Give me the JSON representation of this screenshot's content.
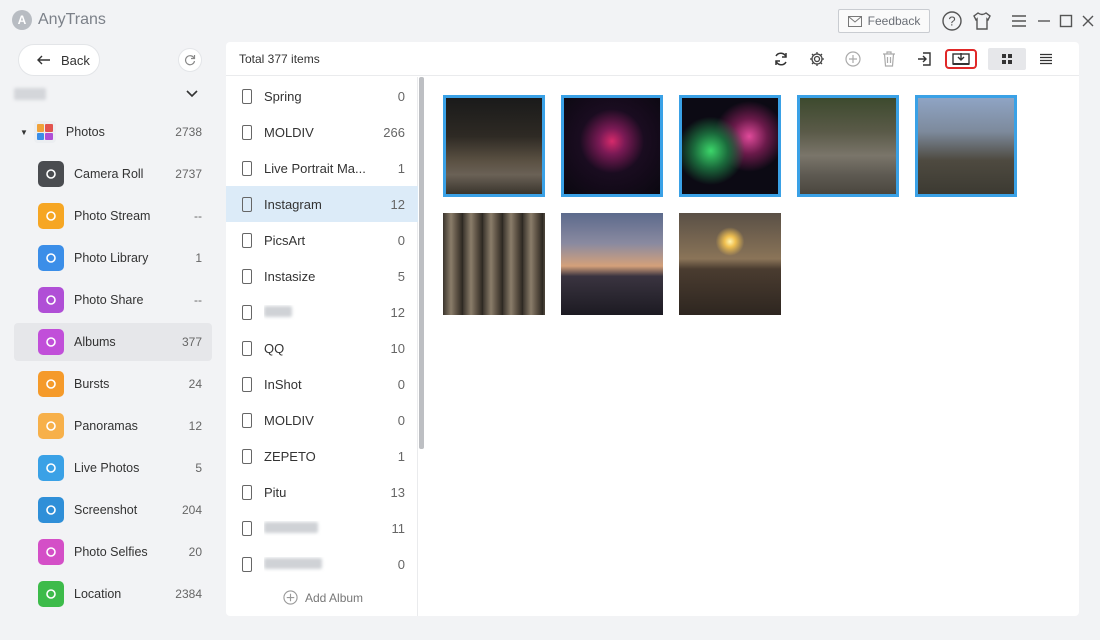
{
  "app": {
    "title": "AnyTrans",
    "logo_letter": "A",
    "feedback_label": "Feedback"
  },
  "sidebar": {
    "back_label": "Back",
    "photos_label": "Photos",
    "photos_count": "2738",
    "categories": [
      {
        "label": "Camera Roll",
        "count": "2737",
        "icon": "camera-icon",
        "color": "#4a4c50"
      },
      {
        "label": "Photo Stream",
        "count": "--",
        "icon": "sunflower-icon",
        "color": "#f6a623"
      },
      {
        "label": "Photo Library",
        "count": "1",
        "icon": "folder-icon",
        "color": "#3b8ee8"
      },
      {
        "label": "Photo Share",
        "count": "--",
        "icon": "share-icon",
        "color": "#b04fd6"
      },
      {
        "label": "Albums",
        "count": "377",
        "icon": "albums-icon",
        "color": "#c14fd9"
      },
      {
        "label": "Bursts",
        "count": "24",
        "icon": "bursts-icon",
        "color": "#f59a2a"
      },
      {
        "label": "Panoramas",
        "count": "12",
        "icon": "panorama-icon",
        "color": "#f7b04a"
      },
      {
        "label": "Live Photos",
        "count": "5",
        "icon": "live-photos-icon",
        "color": "#3aa1e6"
      },
      {
        "label": "Screenshot",
        "count": "204",
        "icon": "screenshot-icon",
        "color": "#2f8fd8"
      },
      {
        "label": "Photo Selfies",
        "count": "20",
        "icon": "selfie-icon",
        "color": "#d44fc7"
      },
      {
        "label": "Location",
        "count": "2384",
        "icon": "location-icon",
        "color": "#3dbb4a"
      }
    ]
  },
  "main": {
    "total_label": "Total 377 items",
    "add_album_label": "Add Album",
    "albums": [
      {
        "label": "Spring",
        "count": "0"
      },
      {
        "label": "MOLDIV",
        "count": "266"
      },
      {
        "label": "Live Portrait Ma...",
        "count": "1"
      },
      {
        "label": "Instagram",
        "count": "12"
      },
      {
        "label": "PicsArt",
        "count": "0"
      },
      {
        "label": "Instasize",
        "count": "5"
      },
      {
        "label": "",
        "count": "12"
      },
      {
        "label": "QQ",
        "count": "10"
      },
      {
        "label": "InShot",
        "count": "0"
      },
      {
        "label": "MOLDIV",
        "count": "0"
      },
      {
        "label": "ZEPETO",
        "count": "1"
      },
      {
        "label": "Pitu",
        "count": "13"
      },
      {
        "label": "",
        "count": "11"
      },
      {
        "label": "",
        "count": "0"
      }
    ]
  },
  "colors": {
    "accent": "#3aa1e6",
    "selected_row": "#dcebf8",
    "highlight_border": "#e02828"
  }
}
